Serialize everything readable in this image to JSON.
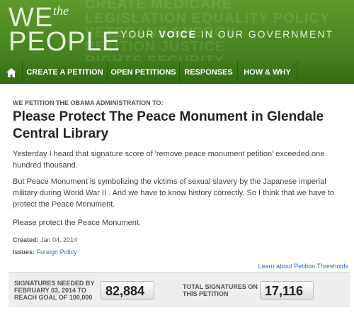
{
  "header": {
    "logo_we": "WE",
    "logo_the": "the",
    "logo_people": "PEOPLE",
    "tagline_part1": "YOUR ",
    "tagline_accent": "VOICE",
    "tagline_part2": " IN OUR GOVERNMENT",
    "bg_words": [
      "CREATE   MEDICARE",
      "LEGISLATION EQUALITY POLICY",
      "VETERANS      ENERGY",
      "PETITION   JUSTICE",
      "RIGHTS   SECURITY"
    ]
  },
  "nav": {
    "home_icon": "home-icon",
    "items": [
      {
        "label": "CREATE A PETITION"
      },
      {
        "label": "OPEN PETITIONS"
      },
      {
        "label": "RESPONSES"
      },
      {
        "label": "HOW & WHY"
      }
    ]
  },
  "petition": {
    "kicker": "WE PETITION THE OBAMA ADMINISTRATION TO:",
    "title": "Please Protect The Peace Monument in Glendale Central Library",
    "paragraphs": [
      "Yesterday I heard that signature score of 'remove peace monument petition' exceeded one hundred thousand.",
      "But Peace Monument is symbolizing the victims of sexual slavery by the Japanese imperial military during World War II . And we have to know history correctly. So I think that we have to protect the Peace Monument.",
      "Please protect the Peace Monument."
    ],
    "created_label": "Created:",
    "created_value": "Jan 04, 2014",
    "issues_label": "Issues:",
    "issues_value": "Foreign Policy"
  },
  "signatures": {
    "learn_link": "Learn about Petition Thresholds",
    "needed_label_line1": "SIGNATURES NEEDED BY",
    "needed_label_line2": "FEBRUARY 03, 2014 TO",
    "needed_label_line3": "REACH GOAL OF 100,000",
    "needed_value": "82,884",
    "total_label_line1": "TOTAL SIGNATURES ON",
    "total_label_line2": "THIS PETITION",
    "total_value": "17,116"
  },
  "colors": {
    "header_green": "#5f9a2c",
    "nav_green": "#3f7d1a",
    "link_blue": "#2f6db5"
  }
}
